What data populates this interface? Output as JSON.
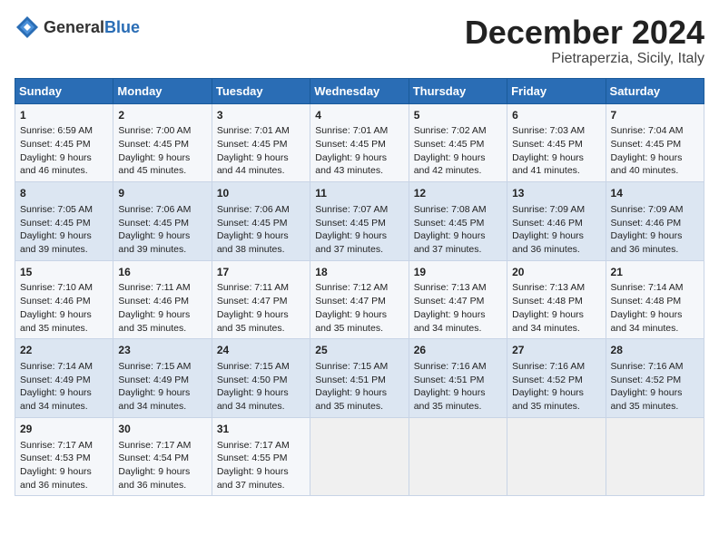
{
  "header": {
    "logo_general": "General",
    "logo_blue": "Blue",
    "month": "December 2024",
    "location": "Pietraperzia, Sicily, Italy"
  },
  "days_of_week": [
    "Sunday",
    "Monday",
    "Tuesday",
    "Wednesday",
    "Thursday",
    "Friday",
    "Saturday"
  ],
  "weeks": [
    [
      {
        "day": 1,
        "sunrise": "Sunrise: 6:59 AM",
        "sunset": "Sunset: 4:45 PM",
        "daylight": "Daylight: 9 hours and 46 minutes."
      },
      {
        "day": 2,
        "sunrise": "Sunrise: 7:00 AM",
        "sunset": "Sunset: 4:45 PM",
        "daylight": "Daylight: 9 hours and 45 minutes."
      },
      {
        "day": 3,
        "sunrise": "Sunrise: 7:01 AM",
        "sunset": "Sunset: 4:45 PM",
        "daylight": "Daylight: 9 hours and 44 minutes."
      },
      {
        "day": 4,
        "sunrise": "Sunrise: 7:01 AM",
        "sunset": "Sunset: 4:45 PM",
        "daylight": "Daylight: 9 hours and 43 minutes."
      },
      {
        "day": 5,
        "sunrise": "Sunrise: 7:02 AM",
        "sunset": "Sunset: 4:45 PM",
        "daylight": "Daylight: 9 hours and 42 minutes."
      },
      {
        "day": 6,
        "sunrise": "Sunrise: 7:03 AM",
        "sunset": "Sunset: 4:45 PM",
        "daylight": "Daylight: 9 hours and 41 minutes."
      },
      {
        "day": 7,
        "sunrise": "Sunrise: 7:04 AM",
        "sunset": "Sunset: 4:45 PM",
        "daylight": "Daylight: 9 hours and 40 minutes."
      }
    ],
    [
      {
        "day": 8,
        "sunrise": "Sunrise: 7:05 AM",
        "sunset": "Sunset: 4:45 PM",
        "daylight": "Daylight: 9 hours and 39 minutes."
      },
      {
        "day": 9,
        "sunrise": "Sunrise: 7:06 AM",
        "sunset": "Sunset: 4:45 PM",
        "daylight": "Daylight: 9 hours and 39 minutes."
      },
      {
        "day": 10,
        "sunrise": "Sunrise: 7:06 AM",
        "sunset": "Sunset: 4:45 PM",
        "daylight": "Daylight: 9 hours and 38 minutes."
      },
      {
        "day": 11,
        "sunrise": "Sunrise: 7:07 AM",
        "sunset": "Sunset: 4:45 PM",
        "daylight": "Daylight: 9 hours and 37 minutes."
      },
      {
        "day": 12,
        "sunrise": "Sunrise: 7:08 AM",
        "sunset": "Sunset: 4:45 PM",
        "daylight": "Daylight: 9 hours and 37 minutes."
      },
      {
        "day": 13,
        "sunrise": "Sunrise: 7:09 AM",
        "sunset": "Sunset: 4:46 PM",
        "daylight": "Daylight: 9 hours and 36 minutes."
      },
      {
        "day": 14,
        "sunrise": "Sunrise: 7:09 AM",
        "sunset": "Sunset: 4:46 PM",
        "daylight": "Daylight: 9 hours and 36 minutes."
      }
    ],
    [
      {
        "day": 15,
        "sunrise": "Sunrise: 7:10 AM",
        "sunset": "Sunset: 4:46 PM",
        "daylight": "Daylight: 9 hours and 35 minutes."
      },
      {
        "day": 16,
        "sunrise": "Sunrise: 7:11 AM",
        "sunset": "Sunset: 4:46 PM",
        "daylight": "Daylight: 9 hours and 35 minutes."
      },
      {
        "day": 17,
        "sunrise": "Sunrise: 7:11 AM",
        "sunset": "Sunset: 4:47 PM",
        "daylight": "Daylight: 9 hours and 35 minutes."
      },
      {
        "day": 18,
        "sunrise": "Sunrise: 7:12 AM",
        "sunset": "Sunset: 4:47 PM",
        "daylight": "Daylight: 9 hours and 35 minutes."
      },
      {
        "day": 19,
        "sunrise": "Sunrise: 7:13 AM",
        "sunset": "Sunset: 4:47 PM",
        "daylight": "Daylight: 9 hours and 34 minutes."
      },
      {
        "day": 20,
        "sunrise": "Sunrise: 7:13 AM",
        "sunset": "Sunset: 4:48 PM",
        "daylight": "Daylight: 9 hours and 34 minutes."
      },
      {
        "day": 21,
        "sunrise": "Sunrise: 7:14 AM",
        "sunset": "Sunset: 4:48 PM",
        "daylight": "Daylight: 9 hours and 34 minutes."
      }
    ],
    [
      {
        "day": 22,
        "sunrise": "Sunrise: 7:14 AM",
        "sunset": "Sunset: 4:49 PM",
        "daylight": "Daylight: 9 hours and 34 minutes."
      },
      {
        "day": 23,
        "sunrise": "Sunrise: 7:15 AM",
        "sunset": "Sunset: 4:49 PM",
        "daylight": "Daylight: 9 hours and 34 minutes."
      },
      {
        "day": 24,
        "sunrise": "Sunrise: 7:15 AM",
        "sunset": "Sunset: 4:50 PM",
        "daylight": "Daylight: 9 hours and 34 minutes."
      },
      {
        "day": 25,
        "sunrise": "Sunrise: 7:15 AM",
        "sunset": "Sunset: 4:51 PM",
        "daylight": "Daylight: 9 hours and 35 minutes."
      },
      {
        "day": 26,
        "sunrise": "Sunrise: 7:16 AM",
        "sunset": "Sunset: 4:51 PM",
        "daylight": "Daylight: 9 hours and 35 minutes."
      },
      {
        "day": 27,
        "sunrise": "Sunrise: 7:16 AM",
        "sunset": "Sunset: 4:52 PM",
        "daylight": "Daylight: 9 hours and 35 minutes."
      },
      {
        "day": 28,
        "sunrise": "Sunrise: 7:16 AM",
        "sunset": "Sunset: 4:52 PM",
        "daylight": "Daylight: 9 hours and 35 minutes."
      }
    ],
    [
      {
        "day": 29,
        "sunrise": "Sunrise: 7:17 AM",
        "sunset": "Sunset: 4:53 PM",
        "daylight": "Daylight: 9 hours and 36 minutes."
      },
      {
        "day": 30,
        "sunrise": "Sunrise: 7:17 AM",
        "sunset": "Sunset: 4:54 PM",
        "daylight": "Daylight: 9 hours and 36 minutes."
      },
      {
        "day": 31,
        "sunrise": "Sunrise: 7:17 AM",
        "sunset": "Sunset: 4:55 PM",
        "daylight": "Daylight: 9 hours and 37 minutes."
      },
      null,
      null,
      null,
      null
    ]
  ]
}
